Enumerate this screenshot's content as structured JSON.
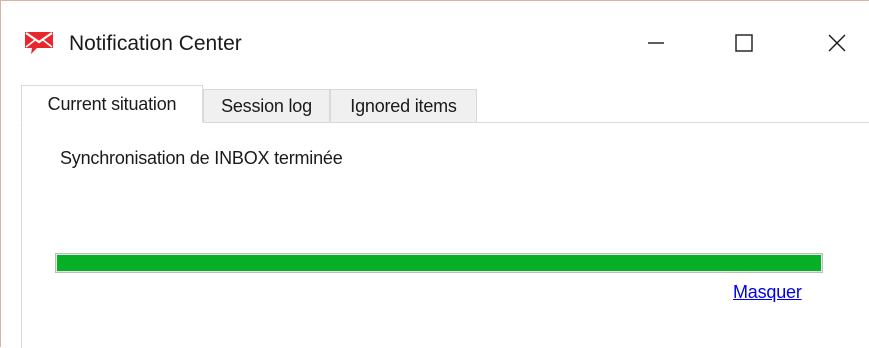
{
  "window": {
    "title": "Notification Center",
    "icon": "red-envelope-icon",
    "controls": {
      "minimize": "minimize-icon",
      "maximize": "maximize-icon",
      "close": "close-icon"
    }
  },
  "tabs": [
    {
      "label": "Current situation",
      "active": true
    },
    {
      "label": "Session log",
      "active": false
    },
    {
      "label": "Ignored items",
      "active": false
    }
  ],
  "current": {
    "status": "Synchronisation de INBOX terminée",
    "progress_percent": 100,
    "hide_link": "Masquer"
  },
  "colors": {
    "progress_fill": "#06b025",
    "link": "#0000ee",
    "icon_red": "#e8262d"
  }
}
